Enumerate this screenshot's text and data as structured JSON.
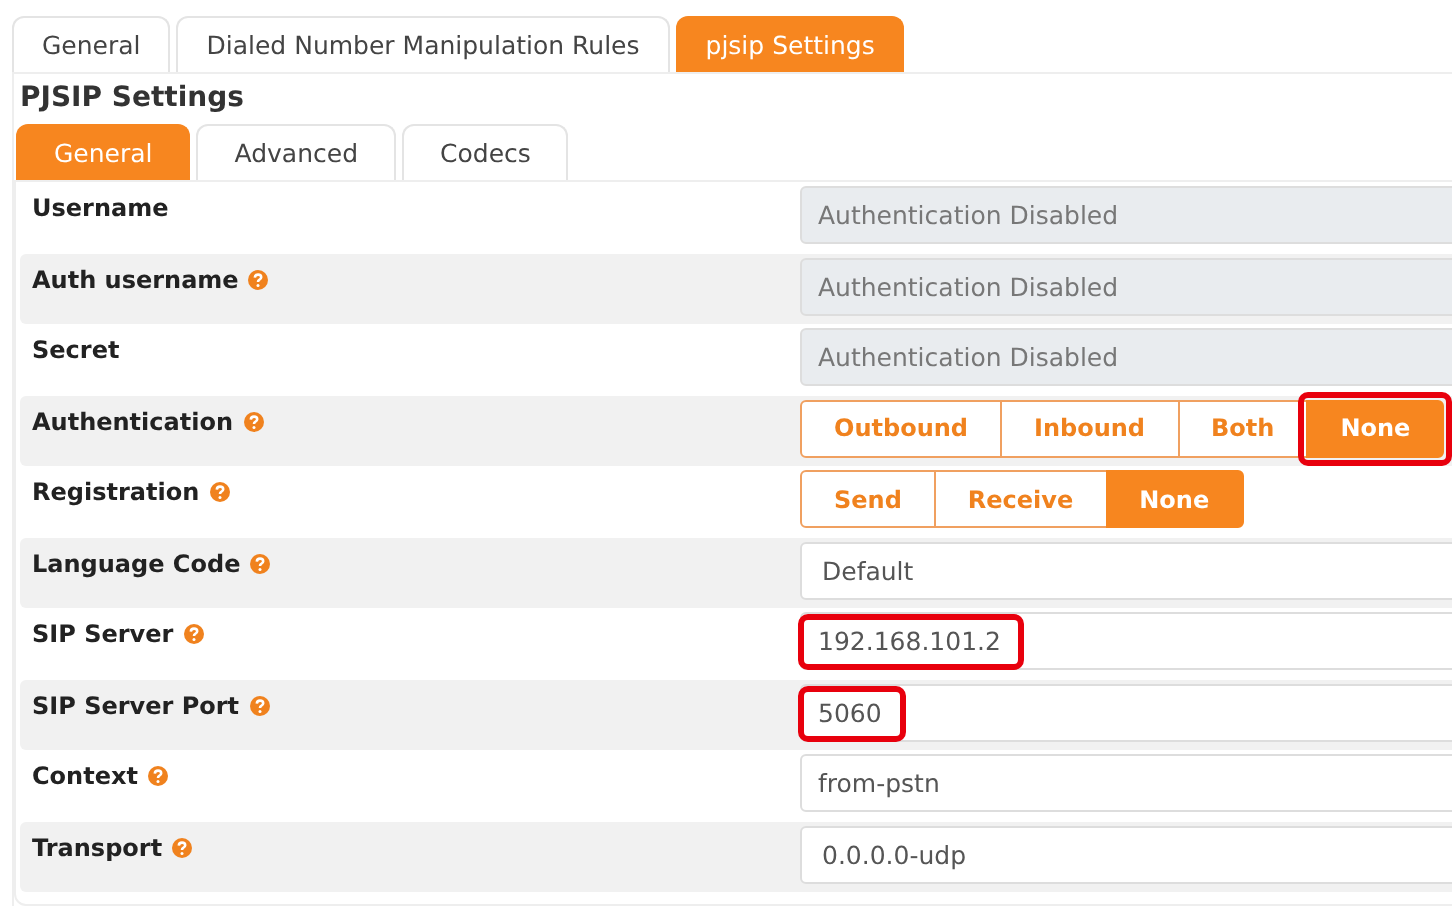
{
  "top_tabs": [
    {
      "label": "General",
      "selected": false
    },
    {
      "label": "Dialed Number Manipulation Rules",
      "selected": false
    },
    {
      "label": "pjsip Settings",
      "selected": true
    }
  ],
  "heading": "PJSIP Settings",
  "sub_tabs": [
    {
      "label": "General",
      "selected": true
    },
    {
      "label": "Advanced",
      "selected": false
    },
    {
      "label": "Codecs",
      "selected": false
    }
  ],
  "rows": [
    {
      "label": "Username",
      "help": false,
      "kind": "text",
      "value": "Authentication Disabled",
      "disabled": true,
      "highlighted": false
    },
    {
      "label": "Auth username",
      "help": true,
      "kind": "text",
      "value": "Authentication Disabled",
      "disabled": true,
      "highlighted": false
    },
    {
      "label": "Secret",
      "help": false,
      "kind": "text",
      "value": "Authentication Disabled",
      "disabled": true,
      "highlighted": false
    },
    {
      "label": "Authentication",
      "help": true,
      "kind": "buttons",
      "options": [
        {
          "label": "Outbound",
          "selected": false,
          "highlighted": false
        },
        {
          "label": "Inbound",
          "selected": false,
          "highlighted": false
        },
        {
          "label": "Both",
          "selected": false,
          "highlighted": false
        },
        {
          "label": "None",
          "selected": true,
          "highlighted": true
        }
      ]
    },
    {
      "label": "Registration",
      "help": true,
      "kind": "buttons",
      "options": [
        {
          "label": "Send",
          "selected": false,
          "highlighted": false
        },
        {
          "label": "Receive",
          "selected": false,
          "highlighted": false
        },
        {
          "label": "None",
          "selected": true,
          "highlighted": false
        }
      ]
    },
    {
      "label": "Language Code",
      "help": true,
      "kind": "select",
      "value": "Default",
      "disabled": false,
      "highlighted": false
    },
    {
      "label": "SIP Server",
      "help": true,
      "kind": "text",
      "value": "192.168.101.2",
      "disabled": false,
      "highlighted": true
    },
    {
      "label": "SIP Server Port",
      "help": true,
      "kind": "text",
      "value": "5060",
      "disabled": false,
      "highlighted": true
    },
    {
      "label": "Context",
      "help": true,
      "kind": "text",
      "value": "from-pstn",
      "disabled": false,
      "highlighted": false
    },
    {
      "label": "Transport",
      "help": true,
      "kind": "select",
      "value": "0.0.0.0-udp",
      "disabled": false,
      "highlighted": false
    }
  ]
}
